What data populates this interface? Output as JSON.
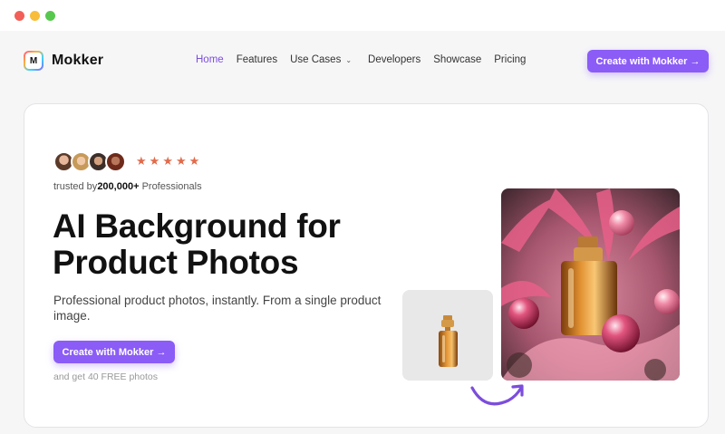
{
  "window": {
    "controls": [
      "close",
      "minimize",
      "maximize"
    ]
  },
  "brand": {
    "logo_letter": "M",
    "name": "Mokker"
  },
  "nav": {
    "items": [
      {
        "label": "Home",
        "active": true
      },
      {
        "label": "Features",
        "active": false
      },
      {
        "label": "Use Cases",
        "active": false,
        "has_dropdown": true
      },
      {
        "label": "Developers",
        "active": false
      },
      {
        "label": "Showcase",
        "active": false
      },
      {
        "label": "Pricing",
        "active": false
      }
    ],
    "cta_label": "Create with Mokker →"
  },
  "hero": {
    "rating_stars": 5,
    "trusted_prefix": "trusted by",
    "trusted_count": "200,000+",
    "trusted_suffix": "Professionals",
    "headline_line1": "AI Background for",
    "headline_line2": "Product Photos",
    "subtitle": "Professional product photos, instantly. From a single product image.",
    "cta_label": "Create with Mokker →",
    "cta_note": "and get 40 FREE photos"
  },
  "colors": {
    "accent": "#8b5cf6",
    "star": "#e06c4c",
    "active_nav": "#7c4ddc"
  },
  "icons": [
    "chevron-down-icon",
    "star-icon",
    "curved-arrow-icon"
  ]
}
